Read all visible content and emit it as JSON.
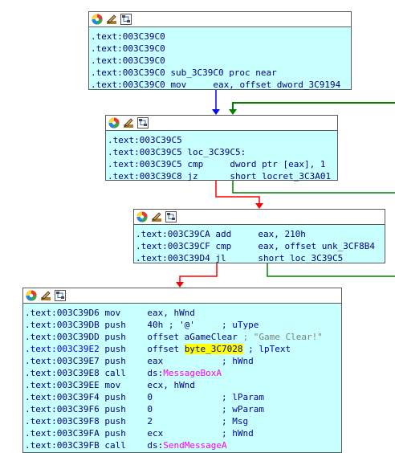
{
  "colors": {
    "node_bg": "#c8ffff",
    "edge_true": "#008000",
    "edge_false": "#ff0000",
    "edge_uncond": "#0000ff",
    "highlight": "#ffff00",
    "api_call": "#ff00ff"
  },
  "header_icons": [
    "palette-icon",
    "edit-icon",
    "graph-icon"
  ],
  "nodes": [
    {
      "id": "block-3c39c0",
      "lines": [
        {
          "addr": ".text:003C39C0",
          "text": ""
        },
        {
          "addr": ".text:003C39C0",
          "text": ""
        },
        {
          "addr": ".text:003C39C0",
          "text": ""
        },
        {
          "addr": ".text:003C39C0",
          "text": " sub_3C39C0 proc near"
        },
        {
          "addr": ".text:003C39C0",
          "mn": "mov",
          "op": "eax, offset dword_3C9194"
        }
      ]
    },
    {
      "id": "block-3c39c5",
      "lines": [
        {
          "addr": ".text:003C39C5",
          "text": ""
        },
        {
          "addr": ".text:003C39C5",
          "text": " loc_3C39C5:"
        },
        {
          "addr": ".text:003C39C5",
          "mn": "cmp",
          "op": "dword ptr [eax], 1"
        },
        {
          "addr": ".text:003C39C8",
          "mn": "jz",
          "op": "short locret_3C3A01"
        }
      ]
    },
    {
      "id": "block-3c39ca",
      "lines": [
        {
          "addr": ".text:003C39CA",
          "mn": "add",
          "op": "eax, 210h"
        },
        {
          "addr": ".text:003C39CF",
          "mn": "cmp",
          "op": "eax, offset unk_3CF8B4"
        },
        {
          "addr": ".text:003C39D4",
          "mn": "jl",
          "op": "short loc_3C39C5"
        }
      ]
    },
    {
      "id": "block-3c39d6",
      "lines": [
        {
          "addr": ".text:003C39D6",
          "mn": "mov",
          "op": "eax, hWnd"
        },
        {
          "addr": ".text:003C39DB",
          "mn": "push",
          "op": "40h ; '@'",
          "cmt": "; uType"
        },
        {
          "addr": ".text:003C39DD",
          "mn": "push",
          "op": "offset aGameClear ",
          "str": "; \"Game Clear!\""
        },
        {
          "addr": ".text:003C39E2",
          "mn": "push",
          "op": "offset ",
          "hl": "byte_3C7028",
          "cmt": " ; lpText",
          "addr_hl": true
        },
        {
          "addr": ".text:003C39E7",
          "mn": "push",
          "op": "eax",
          "cmt": "; hWnd"
        },
        {
          "addr": ".text:003C39E8",
          "mn": "call",
          "op": "ds:",
          "api": "MessageBoxA"
        },
        {
          "addr": ".text:003C39EE",
          "mn": "mov",
          "op": "ecx, hWnd"
        },
        {
          "addr": ".text:003C39F4",
          "mn": "push",
          "op": "0",
          "cmt": "; lParam"
        },
        {
          "addr": ".text:003C39F6",
          "mn": "push",
          "op": "0",
          "cmt": "; wParam"
        },
        {
          "addr": ".text:003C39F8",
          "mn": "push",
          "op": "2",
          "cmt": "; Msg"
        },
        {
          "addr": ".text:003C39FA",
          "mn": "push",
          "op": "ecx",
          "cmt": "; hWnd"
        },
        {
          "addr": ".text:003C39FB",
          "mn": "call",
          "op": "ds:",
          "api": "SendMessageA"
        }
      ]
    }
  ]
}
